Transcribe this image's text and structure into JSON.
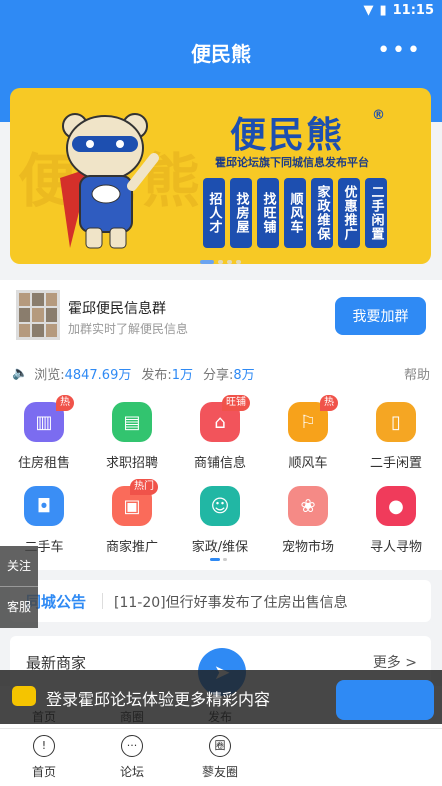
{
  "status": {
    "time": "11:15"
  },
  "header": {
    "title": "便民熊",
    "more_icon": "more-dots-icon"
  },
  "banner": {
    "logo": "便民熊",
    "reg": "®",
    "slogan": "霍邱论坛旗下同城信息发布平台",
    "ghost": "便民熊",
    "tags": [
      "招人才",
      "找房屋",
      "找旺铺",
      "顺风车",
      "家政维保",
      "优惠推广",
      "二手闲置"
    ]
  },
  "group": {
    "name": "霍邱便民信息群",
    "sub": "加群实时了解便民信息",
    "join": "我要加群"
  },
  "stats": {
    "views_label": "浏览:",
    "views": "4847.69万",
    "posts_label": "发布:",
    "posts": "1万",
    "shares_label": "分享:",
    "shares": "8万",
    "help": "帮助"
  },
  "categories": [
    {
      "label": "住房租售",
      "badge": "热",
      "color": "#7b6cf0",
      "icon": "building-icon"
    },
    {
      "label": "求职招聘",
      "badge": "",
      "color": "#32c46f",
      "icon": "briefcase-icon"
    },
    {
      "label": "商铺信息",
      "badge": "旺铺",
      "color": "#f2545b",
      "icon": "shop-icon"
    },
    {
      "label": "顺风车",
      "badge": "热",
      "color": "#f7a21b",
      "icon": "car-icon"
    },
    {
      "label": "二手闲置",
      "badge": "",
      "color": "#f5a623",
      "icon": "phone-icon"
    },
    {
      "label": "二手车",
      "badge": "",
      "color": "#3a8ef5",
      "icon": "car-front-icon"
    },
    {
      "label": "商家推广",
      "badge": "热门",
      "color": "#fa6b5a",
      "icon": "image-icon"
    },
    {
      "label": "家政/维保",
      "badge": "",
      "color": "#21b7a4",
      "icon": "worker-icon"
    },
    {
      "label": "宠物市场",
      "badge": "",
      "color": "#f58a86",
      "icon": "pet-icon"
    },
    {
      "label": "寻人寻物",
      "badge": "",
      "color": "#f03b5b",
      "icon": "drop-icon"
    }
  ],
  "notice": {
    "tag": "同城公告",
    "text": "[11-20]但行好事发布了住房出售信息"
  },
  "latest": {
    "title": "最新商家",
    "more": "更多 >"
  },
  "side": {
    "follow": "关注",
    "service": "客服"
  },
  "inner_tabs": {
    "home": "首页",
    "circle": "商圈",
    "publish": "发布"
  },
  "login": {
    "text": "登录霍邱论坛体验更多精彩内容"
  },
  "tabs": [
    {
      "label": "首页",
      "icon": "home-icon",
      "glyph": "!"
    },
    {
      "label": "论坛",
      "icon": "chat-icon",
      "glyph": "···"
    },
    {
      "label": "蓼友圈",
      "icon": "circle-icon",
      "glyph": "圈"
    }
  ]
}
